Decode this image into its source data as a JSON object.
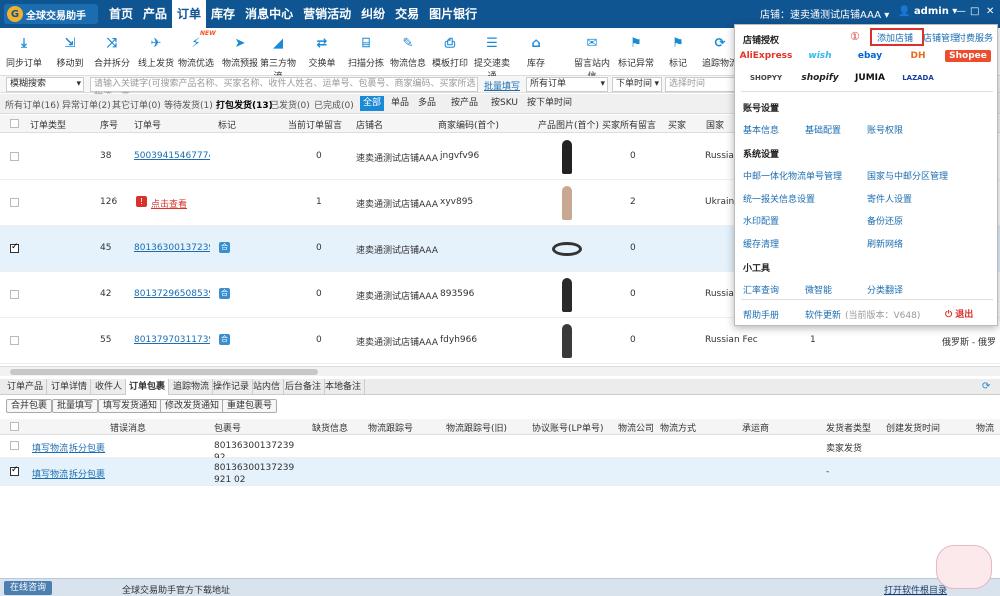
{
  "app": {
    "logo": "全球交易助手",
    "store_label": "店铺：",
    "store_name": "速卖通测试店铺AAA",
    "user": "admin"
  },
  "nav": [
    "首页",
    "产品",
    "订单",
    "库存",
    "消息中心",
    "营销活动",
    "纠纷",
    "交易",
    "图片银行"
  ],
  "nav_tag": "多店铺",
  "toolbar": [
    {
      "label": "同步订单",
      "icon": "download-icon"
    },
    {
      "label": "移动到",
      "icon": "move-icon"
    },
    {
      "label": "合并拆分",
      "icon": "shuffle-icon"
    },
    {
      "label": "线上发货",
      "icon": "plane-icon"
    },
    {
      "label": "物流优选",
      "icon": "truck-icon"
    },
    {
      "label": "物流预报",
      "icon": "paper-plane-icon"
    },
    {
      "label": "第三方物流",
      "icon": "third-party-icon"
    },
    {
      "label": "交换单",
      "icon": "exchange-icon"
    },
    {
      "label": "扫描分拣",
      "icon": "scan-icon"
    },
    {
      "label": "物流信息",
      "icon": "edit-icon"
    },
    {
      "label": "模板打印",
      "icon": "print-icon"
    },
    {
      "label": "提交速卖通",
      "icon": "submit-icon"
    },
    {
      "label": "库存",
      "icon": "warehouse-icon"
    },
    {
      "label": "留言站内信",
      "icon": "message-icon"
    },
    {
      "label": "标记异常",
      "icon": "flag-icon"
    },
    {
      "label": "标记",
      "icon": "flag-icon"
    },
    {
      "label": "追踪物流",
      "icon": "track-icon"
    }
  ],
  "toolbar_new": "NEW",
  "search": {
    "mode": "模糊搜索",
    "placeholder": "请输入关键字(可搜索产品名称、买家名称、收件人姓名、运单号、包裹号、商家编码、买家所选物流、商...",
    "batch": "批量填写",
    "order_filter": "所有订单",
    "time_filter": "下单时间",
    "time_placeholder": "选择时间"
  },
  "filters": [
    "所有订单(16)",
    "异常订单(2)",
    "其它订单(0)",
    "等待发货(1)",
    "打包发货(13)",
    "已发货(0)",
    "已完成(0)"
  ],
  "quick": [
    "全部",
    "单品",
    "多品",
    "按产品",
    "按SKU",
    "按下单时间"
  ],
  "columns": [
    "订单类型",
    "序号",
    "订单号",
    "标记",
    "当前订单留言",
    "店铺名",
    "商家编码(首个)",
    "产品图片(首个)",
    "买家所有留言",
    "买家",
    "国家"
  ],
  "orders": [
    {
      "seq": "38",
      "order": "500394154677740",
      "mark": "0",
      "store": "速卖通测试店铺AAA",
      "sku": "jngvfv96",
      "buyer_msg": "0",
      "country": "Russian",
      "selected": false,
      "badge": "",
      "view": ""
    },
    {
      "seq": "126",
      "order": "",
      "mark": "1",
      "store": "速卖通测试店铺AAA",
      "sku": "xyv895",
      "buyer_msg": "2",
      "country": "Ukraine",
      "selected": false,
      "badge": "red",
      "view": "点击查看"
    },
    {
      "seq": "45",
      "order": "801363001372399",
      "mark": "0",
      "store": "速卖通测试店铺AAA",
      "sku": "",
      "buyer_msg": "0",
      "country": "",
      "selected": true,
      "badge": "合",
      "view": ""
    },
    {
      "seq": "42",
      "order": "801372965085399",
      "mark": "0",
      "store": "速卖通测试店铺AAA",
      "sku": "893596",
      "buyer_msg": "0",
      "country": "Russian",
      "selected": false,
      "badge": "合",
      "view": ""
    },
    {
      "seq": "55",
      "order": "801379703117399",
      "mark": "0",
      "store": "速卖通测试店铺AAA",
      "sku": "fdyh966",
      "buyer_msg": "0",
      "country": "Russian Fec",
      "selected": false,
      "badge": "合",
      "view": "",
      "extra1": "1",
      "extra2": "俄罗斯 - 俄罗"
    }
  ],
  "bottom_tabs": [
    "订单产品",
    "订单详情",
    "收件人",
    "订单包裹",
    "追踪物流",
    "操作记录",
    "站内信",
    "后台备注",
    "本地备注"
  ],
  "bottom_buttons": [
    "合并包裹",
    "批量填写",
    "填写发货通知",
    "修改发货通知",
    "重建包裹号"
  ],
  "pkg_columns": [
    "错误消息",
    "包裹号",
    "缺货信息",
    "物流跟踪号",
    "物流跟踪号(旧)",
    "协议账号(LP单号)",
    "物流公司",
    "物流方式",
    "承运商",
    "发货者类型",
    "创建发货时间",
    "物流"
  ],
  "packages": [
    {
      "fill": "填写物流",
      "split": "拆分包裹",
      "pkg": "80136300137239 92",
      "shipper": "卖家发货",
      "selected": false
    },
    {
      "fill": "填写物流",
      "split": "拆分包裹",
      "pkg": "80136300137239 921 02",
      "shipper": "-",
      "selected": true
    }
  ],
  "status": {
    "online": "在线咨询",
    "notice": "全球交易助手官方下载地址",
    "open": "打开软件根目录"
  },
  "menu": {
    "store_auth": "店铺授权",
    "add_store": "添加店铺",
    "store_mgmt": "店铺管理",
    "pay": "付费服务",
    "marker": "①",
    "brands": [
      "AliExpress",
      "wish",
      "ebay",
      "DH",
      "Shopee",
      "SHOPYY",
      "shopify",
      "JUMIA",
      "LAZADA"
    ],
    "account_settings": "账号设置",
    "account_links": [
      "基本信息",
      "基础配置",
      "账号权限"
    ],
    "system_settings": "系统设置",
    "system_links": [
      "中邮一体化物流单号管理",
      "国家与中邮分区管理",
      "统一报关信息设置",
      "寄件人设置",
      "水印配置",
      "备份还原",
      "缓存清理",
      "刷新网络"
    ],
    "tools": "小工具",
    "tool_links": [
      "汇率查询",
      "微智能",
      "分类翻译"
    ],
    "help": "帮助手册",
    "update": "软件更新",
    "version": "(当前版本：V648)",
    "exit": "退出"
  },
  "colors": {
    "nav_bg": "#0f5592",
    "accent": "#1b6db0",
    "highlight": "#d9322b",
    "selected_row": "#e5f1fb"
  }
}
